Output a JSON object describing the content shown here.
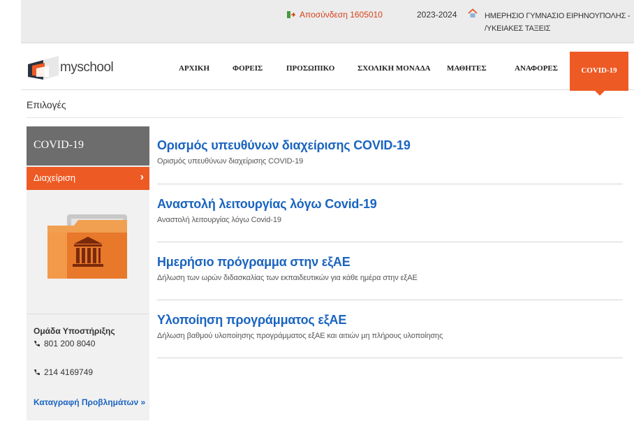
{
  "topbar": {
    "logout": "Αποσύνδεση 1605010",
    "year": "2023-2024",
    "school": "ΗΜΕΡΗΣΙΟ ΓΥΜΝΑΣΙΟ ΕΙΡΗΝΟΥΠΟΛΗΣ - /ΥΚΕΙΑΚΕΣ ΤΑΞΕΙΣ"
  },
  "logo": {
    "text": "myschool"
  },
  "nav": {
    "items": [
      "ΑΡΧΙΚΗ",
      "ΦΟΡΕΙΣ",
      "ΠΡΟΣΩΠΙΚΟ",
      "ΣΧΟΛΙΚΗ ΜΟΝΑΔΑ",
      "ΜΑΘΗΤΕΣ",
      "ΑΝΑΦΟΡΕΣ"
    ],
    "active": "COVID-19"
  },
  "options_label": "Επιλογές",
  "sidebar": {
    "title": "COVID-19",
    "manage": "Διαχείριση",
    "support_title": "Ομάδα Υποστήριξης",
    "phone1": "801 200 8040",
    "phone2": "214 4169749",
    "report_link": "Καταγραφή Προβλημάτων »"
  },
  "entries": [
    {
      "title": "Ορισμός υπευθύνων διαχείρισης COVID-19",
      "desc": "Ορισμός υπευθύνων διαχείρισης COVID-19"
    },
    {
      "title": "Αναστολή λειτουργίας λόγω Covid-19",
      "desc": "Αναστολή λειτουργίας λόγω Covid-19"
    },
    {
      "title": "Ημερήσιο πρόγραμμα στην εξΑΕ",
      "desc": "Δήλωση των ωρών διδασκαλίας των εκπαιδευτικών για κάθε ημέρα στην εξΑΕ"
    },
    {
      "title": "Υλοποίηση προγράμματος εξΑΕ",
      "desc": "Δήλωση βαθμού υλοποίησης προγράμματος εξΑΕ και αιτιών μη πλήρους υλοποίησης"
    }
  ],
  "colors": {
    "accent": "#ee5a24",
    "link": "#1a64c0",
    "sidebar_head": "#6d6d6d"
  },
  "icons": [
    "logout-icon",
    "home-icon",
    "myschool-logo-icon",
    "folder-institution-icon",
    "phone-icon",
    "chevron-right-icon"
  ]
}
